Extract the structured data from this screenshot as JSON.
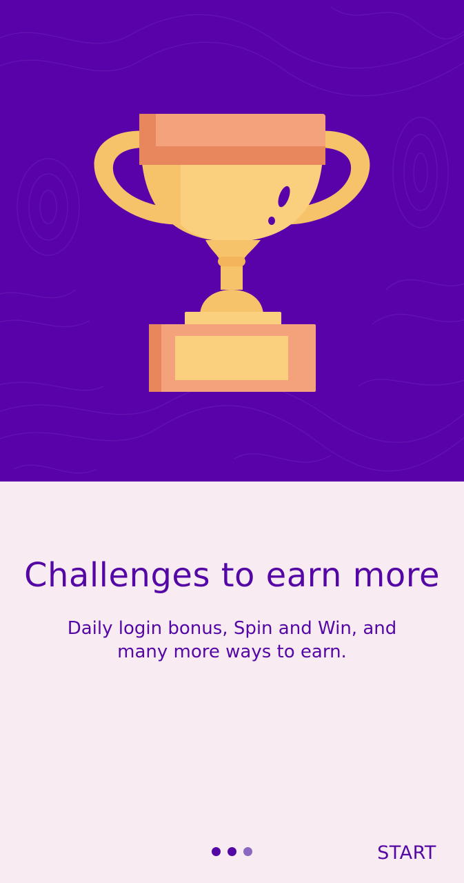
{
  "onboarding": {
    "title": "Challenges to earn more",
    "subtitle_line1": "Daily login bonus, Spin and Win, and",
    "subtitle_line2": "many more ways to earn.",
    "page_indicator": {
      "total": 3,
      "current": 3,
      "active_color": "#5507A5",
      "inactive_color": "#8A67C0"
    },
    "start_label": "START"
  },
  "colors": {
    "hero_background": "#5A02AA",
    "content_background": "#F8ECF2",
    "text_primary": "#5507A5"
  },
  "illustration": {
    "icon": "trophy-icon"
  }
}
